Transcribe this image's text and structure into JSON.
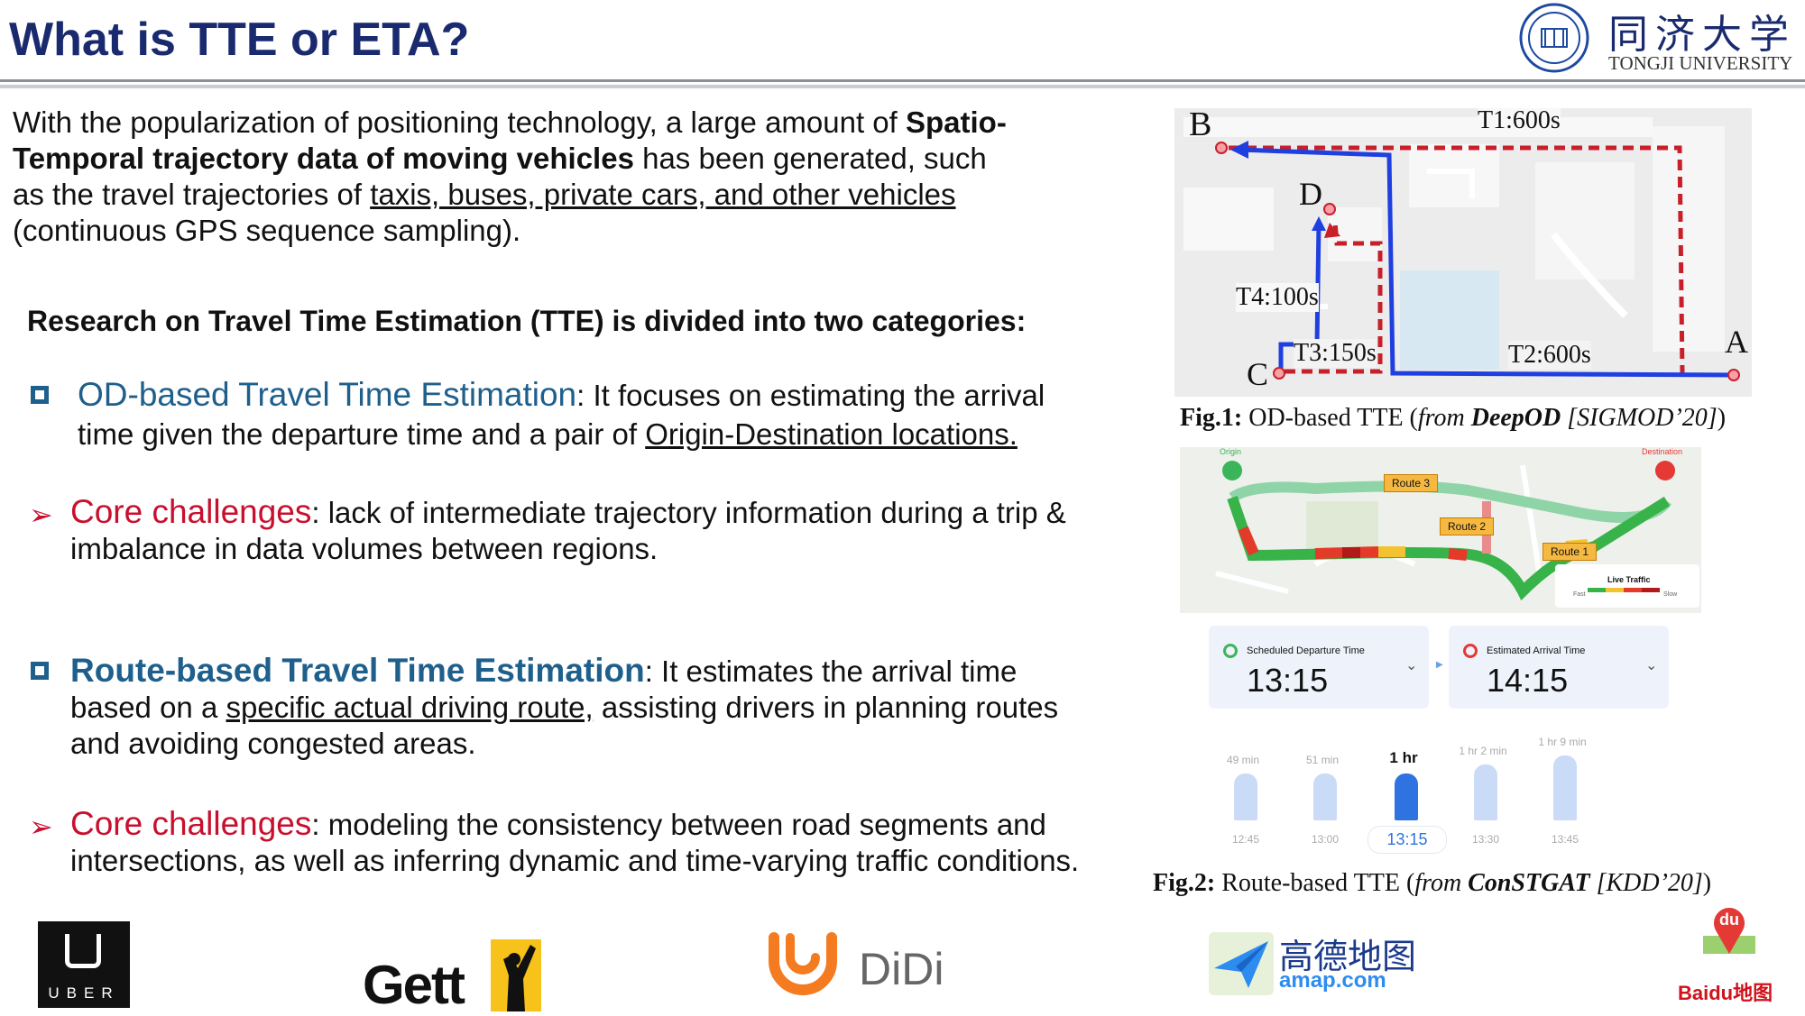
{
  "header": {
    "title": "What is TTE or ETA?",
    "university_en": "TONGJI UNIVERSITY",
    "university_cn": "同济大学"
  },
  "intro": {
    "t1": "With the popularization of positioning technology, a large amount of ",
    "t2": "Spatio-",
    "t3": "Temporal trajectory data of moving vehicles",
    "t4": " has been generated, such",
    "t5": "as the travel trajectories of ",
    "t6": "taxis, buses, private cars, and other vehicles",
    "t7": "(continuous GPS sequence sampling)."
  },
  "research_heading": "Research on Travel Time Estimation (TTE) is divided into two categories:",
  "od": {
    "title": "OD-based Travel Time Estimation",
    "desc1": ": It focuses on estimating the arrival",
    "desc2a": "time given the departure time and a pair of ",
    "desc2b": "Origin-Destination locations.",
    "challenge_label": "Core challenges",
    "challenge1": ": lack of intermediate trajectory information during a trip &",
    "challenge2": "imbalance in data volumes between regions."
  },
  "route": {
    "title": "Route-based Travel Time Estimation",
    "desc1": ": It estimates the arrival time",
    "desc2a": "based on a ",
    "desc2b": "specific actual driving route,",
    "desc2c": " assisting drivers in planning routes",
    "desc3": "and avoiding congested areas.",
    "challenge_label": "Core challenges",
    "challenge1": ": modeling the consistency between road segments and",
    "challenge2": "intersections, as well as inferring dynamic and time-varying traffic conditions."
  },
  "fig1": {
    "labels": {
      "b": "B",
      "d": "D",
      "c": "C",
      "a": "A",
      "t1": "T1:600s",
      "t2": "T2:600s",
      "t3": "T3:150s",
      "t4": "T4:100s"
    },
    "caption_bold": "Fig.1:",
    "caption_text": " OD-based TTE (",
    "caption_from": "from ",
    "caption_model": "DeepOD",
    "caption_venue": " [SIGMOD’20]",
    "caption_end": ")"
  },
  "fig2": {
    "origin": "Origin",
    "destination": "Destination",
    "route1": "Route 1",
    "route2": "Route 2",
    "route3": "Route 3",
    "live_traffic": "Live Traffic",
    "fast": "Fast",
    "slow": "Slow",
    "departure_label": "Scheduled Departure Time",
    "departure_time": "13:15",
    "arrival_label": "Estimated Arrival Time",
    "arrival_time": "14:15",
    "durations": [
      "49 min",
      "51 min",
      "1 hr",
      "1 hr 2 min",
      "1 hr 9 min"
    ],
    "times": [
      "12:45",
      "13:00",
      "13:15",
      "13:30",
      "13:45"
    ],
    "caption_bold": "Fig.2:",
    "caption_text": " Route-based TTE (",
    "caption_from": "from ",
    "caption_model": "ConSTGAT",
    "caption_venue": " [KDD’20]",
    "caption_end": ")"
  },
  "logos": {
    "uber": "UBER",
    "gett": "Gett",
    "didi": "DiDi",
    "amap_cn": "高德地图",
    "amap_en": "amap.com",
    "baidu": "Baidu地图",
    "baidu_du": "du"
  },
  "colors": {
    "title": "#1a2a6e",
    "accent_blue": "#1e5f8c",
    "accent_red": "#c8102e",
    "route_blue": "#1f3fe0",
    "route_red": "#c8202a",
    "didi_orange": "#f47b20"
  }
}
